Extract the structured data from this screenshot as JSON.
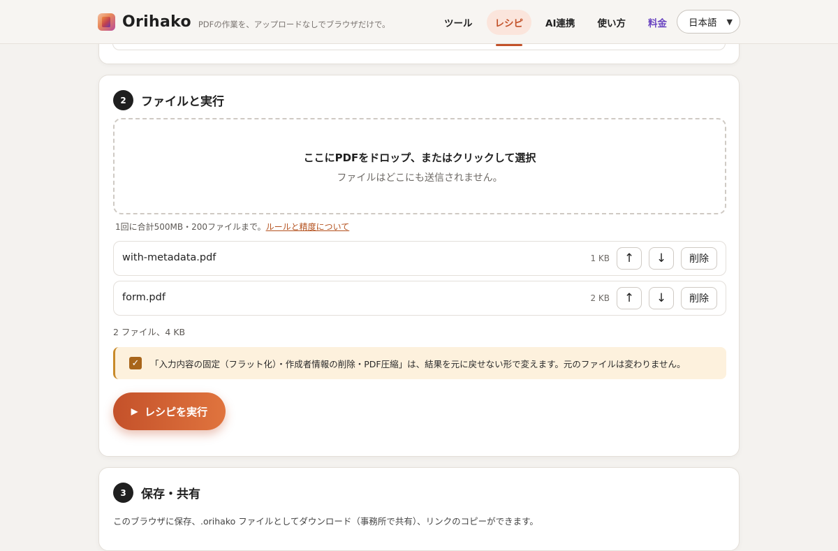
{
  "header": {
    "brand": "Orihako",
    "tagline": "PDFの作業を、アップロードなしでブラウザだけで。",
    "nav": [
      {
        "label": "ツール"
      },
      {
        "label": "レシピ"
      },
      {
        "label": "AI連携"
      },
      {
        "label": "使い方"
      },
      {
        "label": "料金"
      }
    ],
    "active_nav": "レシピ",
    "language": {
      "selected": "日本語"
    }
  },
  "step2": {
    "number": "2",
    "title": "ファイルと実行",
    "dropzone": {
      "title": "ここにPDFをドロップ、またはクリックして選択",
      "subtitle": "ファイルはどこにも送信されません。"
    },
    "limit_note": "1回に合計500MB・200ファイルまで。",
    "limit_link": "ルールと精度について",
    "files": [
      {
        "name": "with-metadata.pdf",
        "size": "1 KB"
      },
      {
        "name": "form.pdf",
        "size": "2 KB"
      }
    ],
    "move_up": "↑",
    "move_down": "↓",
    "delete_label": "削除",
    "summary": "2 ファイル、4 KB",
    "warning": {
      "checked": true,
      "text": "「入力内容の固定（フラット化）・作成者情報の削除・PDF圧縮」は、結果を元に戻せない形で変えます。元のファイルは変わりません。"
    },
    "run_button": "レシピを実行"
  },
  "step3": {
    "number": "3",
    "title": "保存・共有",
    "description": "このブラウザに保存、.orihako ファイルとしてダウンロード（事務所で共有）、リンクのコピーができます。"
  },
  "colors": {
    "accent": "#c2522a",
    "pricing": "#6b46c1",
    "warning_bg": "#fdf1dd"
  }
}
